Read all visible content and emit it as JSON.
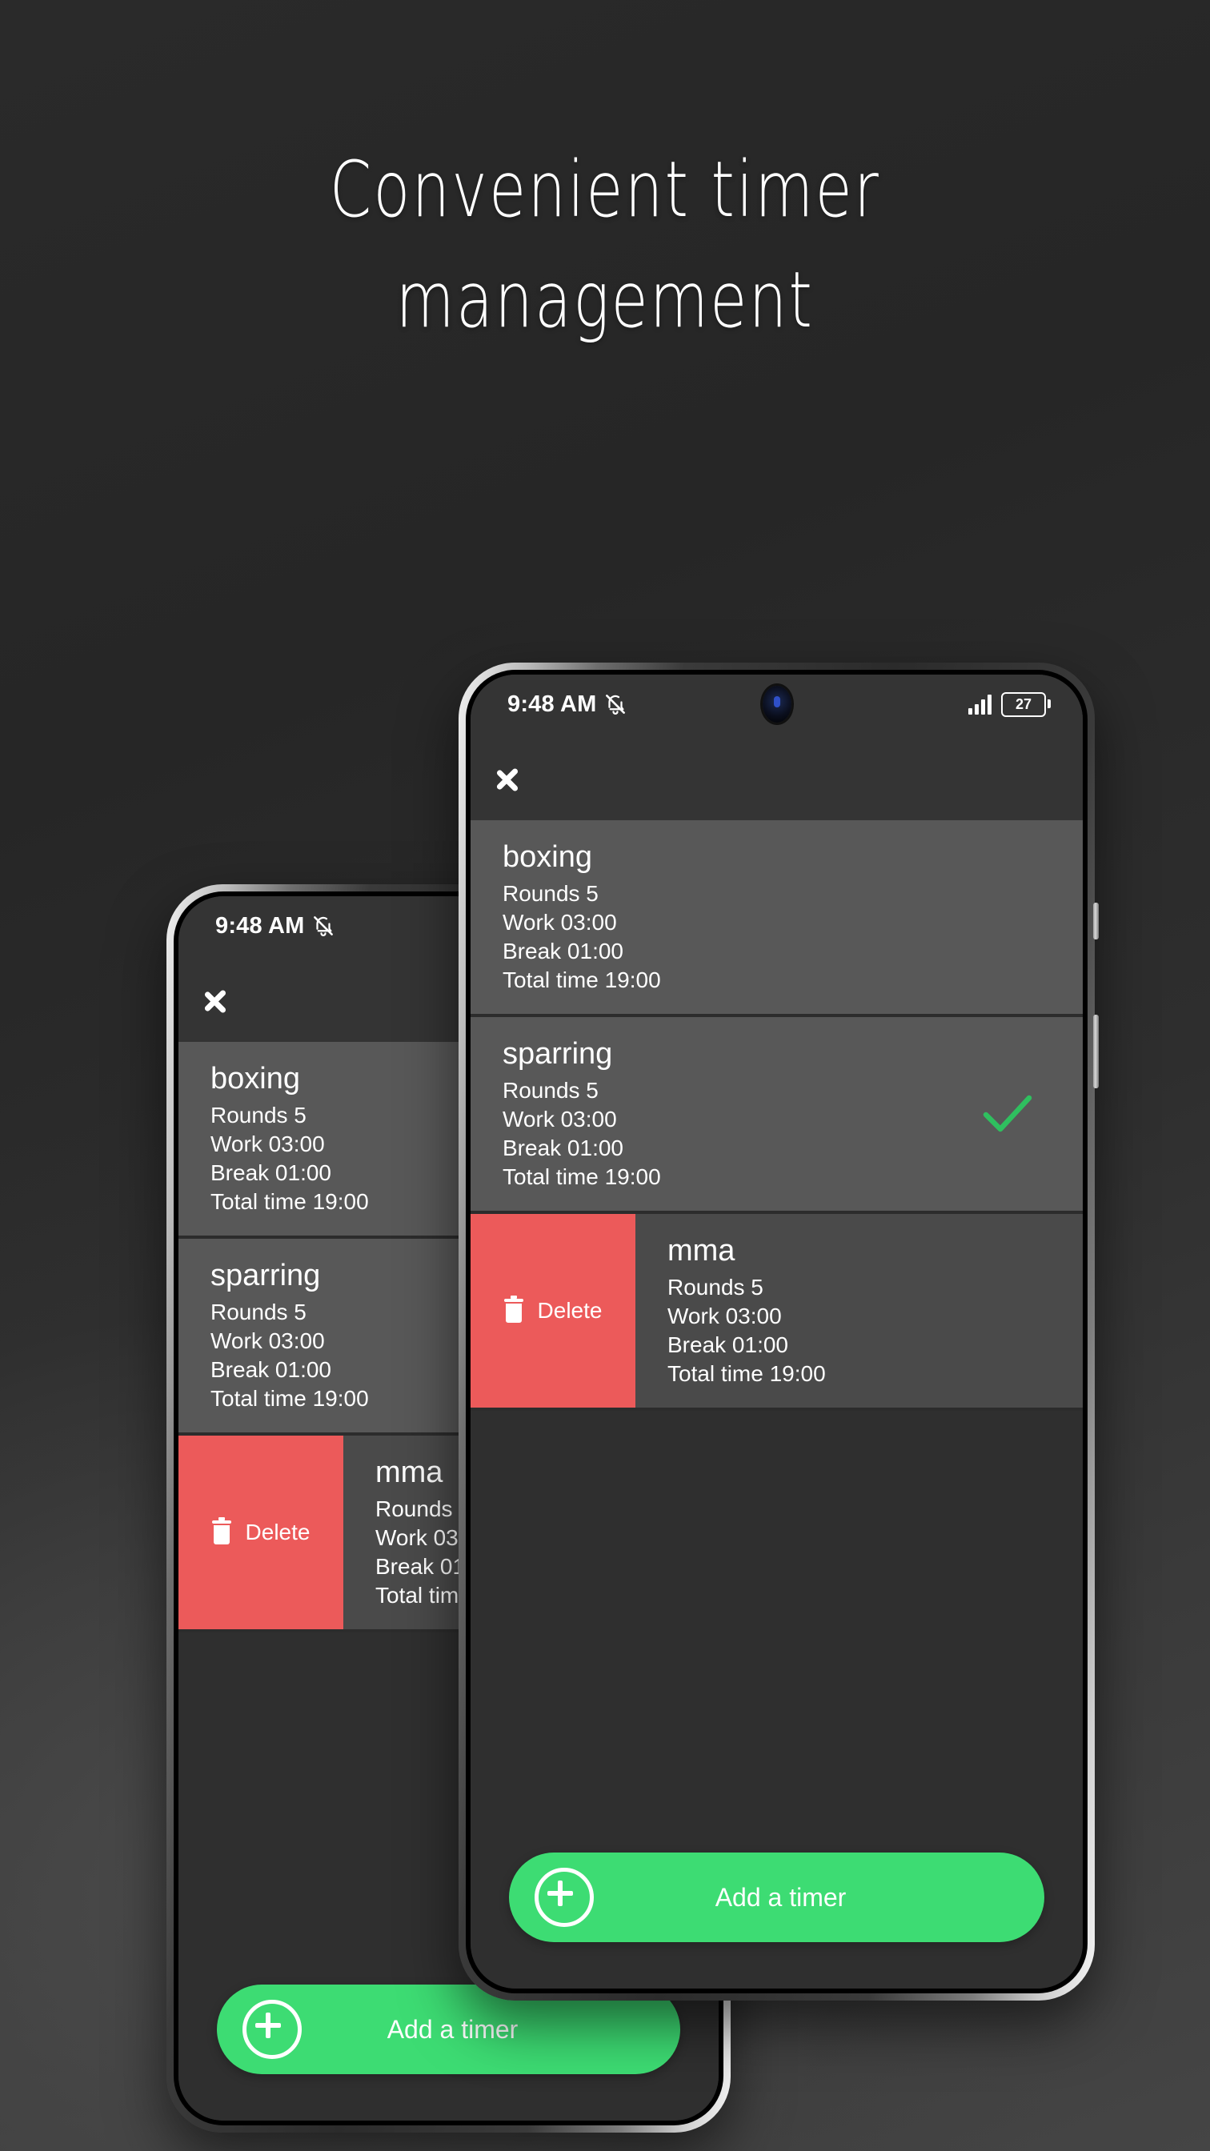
{
  "headline": {
    "line1": "Convenient timer",
    "line2": "management"
  },
  "colors": {
    "accent_green": "#3ddc73",
    "check_green": "#2fbf5f",
    "delete_red": "#ec5a5a",
    "screen_bg": "#2f2f2f",
    "row_bg": "#585858",
    "appbar_bg": "#343434"
  },
  "status_bar": {
    "time": "9:48 AM",
    "mute_icon": "bell-muted-icon",
    "signal_icon": "signal-bars-icon",
    "battery_level": "27",
    "camera": "punch-hole-camera"
  },
  "app_bar": {
    "back_icon": "back-chevron-icon"
  },
  "timers": [
    {
      "name": "boxing",
      "rounds": "Rounds 5",
      "work": "Work 03:00",
      "break": "Break 01:00",
      "total": "Total time 19:00",
      "selected": false,
      "swiped": false
    },
    {
      "name": "sparring",
      "rounds": "Rounds 5",
      "work": "Work 03:00",
      "break": "Break 01:00",
      "total": "Total time 19:00",
      "selected": true,
      "swiped": false
    },
    {
      "name": "mma",
      "rounds": "Rounds 5",
      "work": "Work 03:00",
      "break": "Break 01:00",
      "total": "Total time 19:00",
      "selected": false,
      "swiped": true
    }
  ],
  "swipe_action": {
    "label": "Delete",
    "icon": "trash-icon"
  },
  "add_button": {
    "label": "Add a timer",
    "icon": "plus-circle-icon"
  }
}
